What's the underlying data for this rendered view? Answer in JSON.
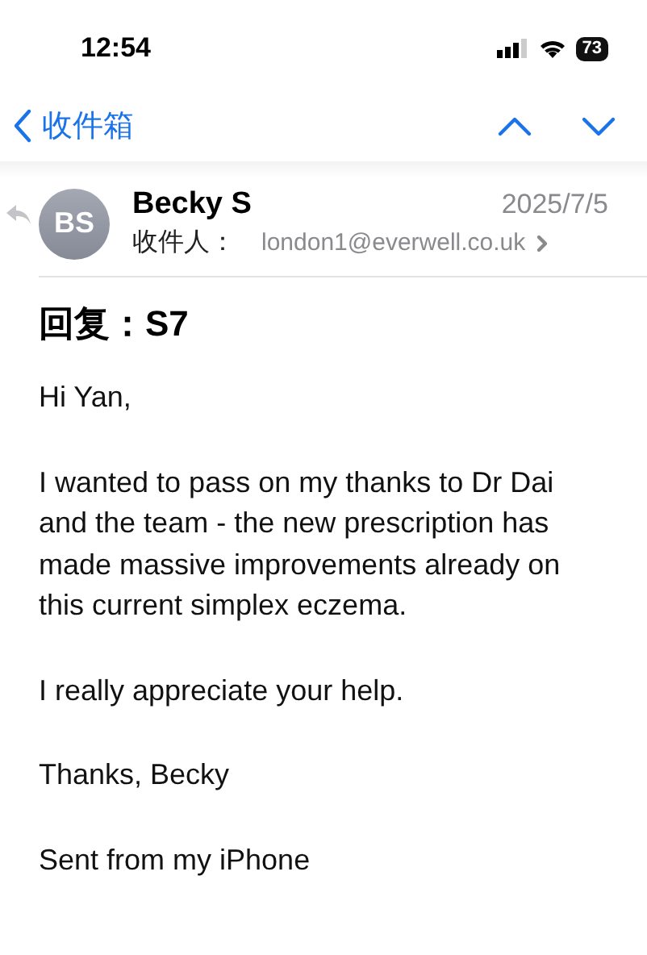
{
  "status_bar": {
    "time": "12:54",
    "battery": "73"
  },
  "nav": {
    "back_label": "收件箱"
  },
  "message": {
    "avatar_initials": "BS",
    "sender": "Becky S",
    "date": "2025/7/5",
    "to_label": "收件人：",
    "to_address": "london1@everwell.co.uk",
    "replied": true,
    "subject": "回复：S7",
    "body": [
      "Hi Yan,",
      "I wanted to pass on my thanks to Dr Dai and the team - the new prescription has made massive improvements already on this current simplex eczema.",
      "I really appreciate your help.",
      "Thanks, Becky",
      "Sent from my iPhone"
    ]
  }
}
